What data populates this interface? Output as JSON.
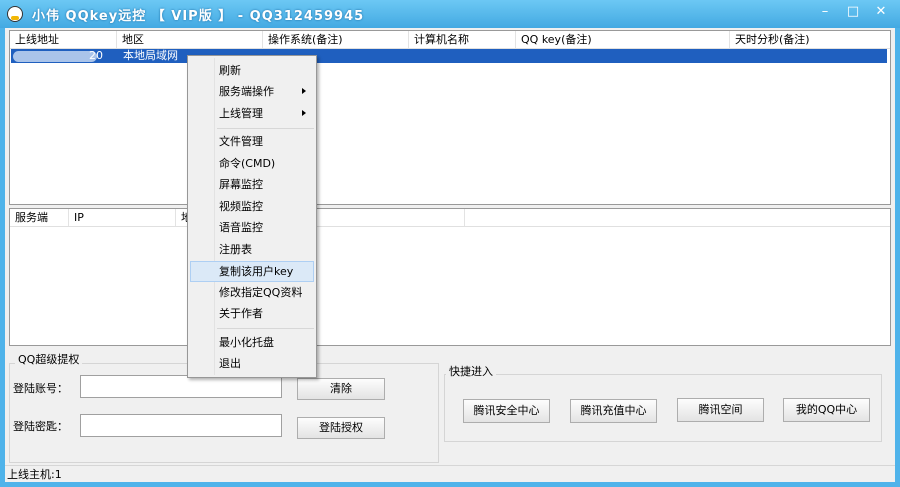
{
  "window": {
    "title": "小伟 QQkey远控 【 VIP版 】 - QQ312459945",
    "minimize": "–",
    "maximize": "□",
    "close": "✕"
  },
  "hosts_table": {
    "columns": [
      "上线地址",
      "地区",
      "操作系统(备注)",
      "计算机名称",
      "QQ key(备注)",
      "天时分秒(备注)"
    ],
    "rows": [
      {
        "address_suffix": "20",
        "region": "本地局域网"
      }
    ]
  },
  "sessions_table": {
    "columns": [
      "服务端",
      "IP",
      "地"
    ]
  },
  "context_menu": {
    "items": [
      {
        "label": "刷新",
        "submenu": false
      },
      {
        "label": "服务端操作",
        "submenu": true
      },
      {
        "label": "上线管理",
        "submenu": true
      },
      {
        "label": "文件管理",
        "submenu": false
      },
      {
        "label": "命令(CMD)",
        "submenu": false
      },
      {
        "label": "屏幕监控",
        "submenu": false
      },
      {
        "label": "视频监控",
        "submenu": false
      },
      {
        "label": "语音监控",
        "submenu": false
      },
      {
        "label": "注册表",
        "submenu": false
      },
      {
        "label": "复制该用户key",
        "submenu": false,
        "highlighted": true
      },
      {
        "label": "修改指定QQ资料",
        "submenu": false
      },
      {
        "label": "关于作者",
        "submenu": false
      },
      {
        "label": "最小化托盘",
        "submenu": false
      },
      {
        "label": "退出",
        "submenu": false
      }
    ]
  },
  "auth_group": {
    "title": "QQ超级提权",
    "account_label": "登陆账号：",
    "password_label": "登陆密匙：",
    "account_value": "",
    "password_value": "",
    "clear_button": "清除",
    "login_button": "登陆授权"
  },
  "quick_group": {
    "title": "快捷进入",
    "buttons": [
      "腾讯安全中心",
      "腾讯充值中心",
      "腾讯空间",
      "我的QQ中心"
    ]
  },
  "status": {
    "online_hosts": "上线主机:1"
  }
}
